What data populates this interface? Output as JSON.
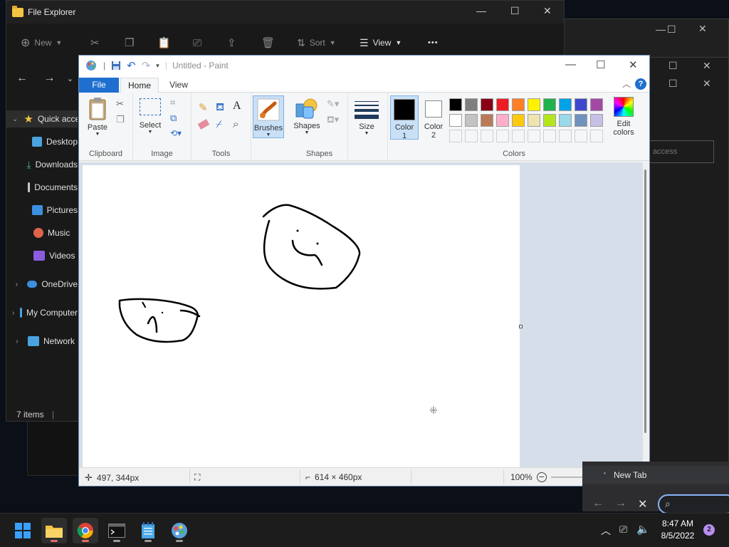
{
  "explorer": {
    "title": "File Explorer",
    "cmd": {
      "new": "New",
      "sort": "Sort",
      "view": "View",
      "more": "•••"
    },
    "tree": [
      {
        "label": "Quick access",
        "color": "#f3c343"
      },
      {
        "label": "Desktop",
        "color": "#4aa3df"
      },
      {
        "label": "Downloads",
        "color": "#3fb67a"
      },
      {
        "label": "Documents",
        "color": "#c9c9c9"
      },
      {
        "label": "Pictures",
        "color": "#3d8fe0"
      },
      {
        "label": "Music",
        "color": "#e0644a"
      },
      {
        "label": "Videos",
        "color": "#8a5ce0"
      },
      {
        "label": "OneDrive",
        "color": "#3d8fe0"
      },
      {
        "label": "My Computer",
        "color": "#4aa3df"
      },
      {
        "label": "Network",
        "color": "#4aa3df"
      }
    ],
    "status": "7 items",
    "quick_access_search": "access"
  },
  "paint": {
    "title": "Untitled - Paint",
    "tabs": {
      "file": "File",
      "home": "Home",
      "view": "View"
    },
    "groups": {
      "clipboard": "Clipboard",
      "image": "Image",
      "tools": "Tools",
      "shapes": "Shapes",
      "colors": "Colors"
    },
    "buttons": {
      "paste": "Paste",
      "select": "Select",
      "brushes": "Brushes",
      "shapes": "Shapes",
      "size": "Size",
      "color1_line1": "Color",
      "color1_line2": "1",
      "color2_line1": "Color",
      "color2_line2": "2",
      "edit_colors_line1": "Edit",
      "edit_colors_line2": "colors"
    },
    "palette_row1": [
      "#000000",
      "#7f7f7f",
      "#880015",
      "#ed1c24",
      "#ff7f27",
      "#fff200",
      "#22b14c",
      "#00a2e8",
      "#3f48cc",
      "#a349a4"
    ],
    "palette_row2": [
      "#ffffff",
      "#c3c3c3",
      "#b97a57",
      "#ffaec9",
      "#ffc90e",
      "#efe4b0",
      "#b5e61d",
      "#99d9ea",
      "#7092be",
      "#c8bfe7"
    ],
    "color1": "#000000",
    "color2": "#ffffff",
    "status": {
      "cursor_pos": "497, 344px",
      "canvas_size": "614 × 460px",
      "zoom": "100%"
    }
  },
  "chrome": {
    "tab_title": "New Tab"
  },
  "taskbar": {
    "time": "8:47 AM",
    "date": "8/5/2022",
    "notifications": "2"
  }
}
